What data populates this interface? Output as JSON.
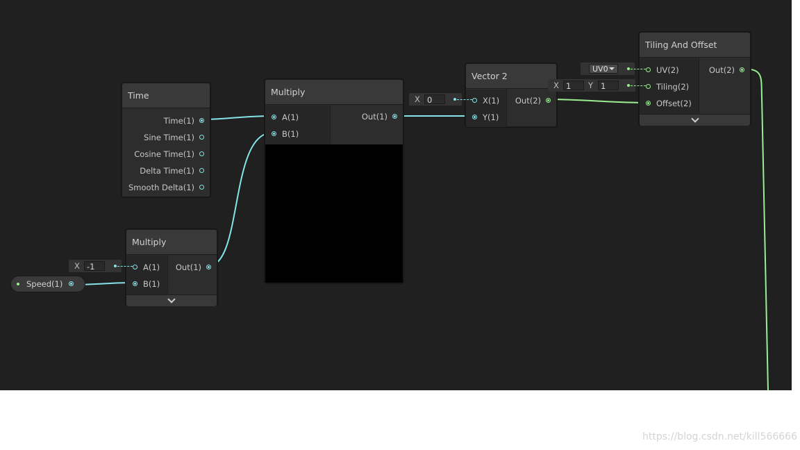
{
  "nodes": {
    "time": {
      "title": "Time",
      "outputs": [
        "Time(1)",
        "Sine Time(1)",
        "Cosine Time(1)",
        "Delta Time(1)",
        "Smooth Delta(1)"
      ]
    },
    "multiply_small": {
      "title": "Multiply",
      "inputs": [
        "A(1)",
        "B(1)"
      ],
      "output": "Out(1)",
      "a_label": "X",
      "a_value": "-1"
    },
    "multiply_main": {
      "title": "Multiply",
      "inputs": [
        "A(1)",
        "B(1)"
      ],
      "output": "Out(1)"
    },
    "vector2": {
      "title": "Vector 2",
      "inputs": [
        "X(1)",
        "Y(1)"
      ],
      "output": "Out(2)",
      "x_label": "X",
      "x_value": "0"
    },
    "tiling": {
      "title": "Tiling And Offset",
      "inputs": [
        "UV(2)",
        "Tiling(2)",
        "Offset(2)"
      ],
      "output": "Out(2)",
      "uv_option": "UV0",
      "tiling_x_label": "X",
      "tiling_x": "1",
      "tiling_y_label": "Y",
      "tiling_y": "1"
    }
  },
  "property": {
    "label": "Speed(1)"
  },
  "watermark": "https://blog.csdn.net/kill566666",
  "colors": {
    "background": "#202020",
    "float_port": "#84e4e7",
    "vector2_port": "#9aef92"
  }
}
